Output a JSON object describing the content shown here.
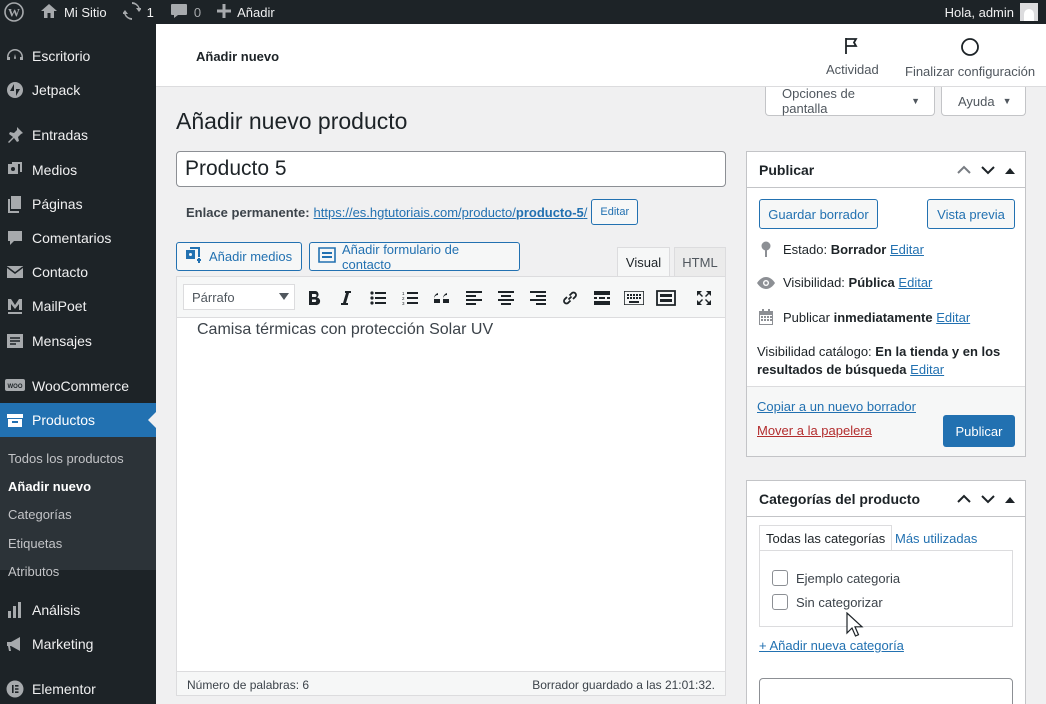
{
  "adminbar": {
    "site_name": "Mi Sitio",
    "updates_count": "1",
    "comments_count": "0",
    "new_label": "Añadir",
    "greeting": "Hola, admin"
  },
  "sidebar": {
    "items": [
      {
        "label": "Escritorio",
        "icon": "dashboard-icon"
      },
      {
        "label": "Jetpack",
        "icon": "jetpack-icon"
      },
      {
        "label": "Entradas",
        "icon": "pin-icon"
      },
      {
        "label": "Medios",
        "icon": "media-icon"
      },
      {
        "label": "Páginas",
        "icon": "pages-icon"
      },
      {
        "label": "Comentarios",
        "icon": "comments-icon"
      },
      {
        "label": "Contacto",
        "icon": "envelope-icon"
      },
      {
        "label": "MailPoet",
        "icon": "mailpoet-icon"
      },
      {
        "label": "Mensajes",
        "icon": "messages-icon"
      },
      {
        "label": "WooCommerce",
        "icon": "woo-icon"
      },
      {
        "label": "Productos",
        "icon": "archive-icon"
      },
      {
        "label": "Análisis",
        "icon": "chart-icon"
      },
      {
        "label": "Marketing",
        "icon": "megaphone-icon"
      },
      {
        "label": "Elementor",
        "icon": "elementor-icon"
      }
    ],
    "submenu": [
      "Todos los productos",
      "Añadir nuevo",
      "Categorías",
      "Etiquetas",
      "Atributos"
    ]
  },
  "header": {
    "title": "Añadir nuevo",
    "activity_label": "Actividad",
    "finish_setup_label": "Finalizar configuración"
  },
  "screen_meta": {
    "options_label": "Opciones de pantalla",
    "help_label": "Ayuda"
  },
  "page": {
    "heading": "Añadir nuevo producto",
    "title_value": "Producto 5",
    "permalink_label": "Enlace permanente:",
    "permalink_base": "https://es.hgtutoriais.com/producto/",
    "permalink_slug": "producto-5",
    "permalink_tail": "/",
    "permalink_edit": "Editar"
  },
  "editor": {
    "add_media_label": "Añadir medios",
    "add_form_label": "Añadir formulario de contacto",
    "tab_visual": "Visual",
    "tab_html": "HTML",
    "format_value": "Párrafo",
    "content": "Camisa térmicas con protección Solar UV",
    "word_count": "Número de palabras: 6",
    "saved_status": "Borrador guardado a las 21:01:32."
  },
  "publish": {
    "title": "Publicar",
    "save_draft": "Guardar borrador",
    "preview": "Vista previa",
    "status_label": "Estado:",
    "status_value": "Borrador",
    "visibility_label": "Visibilidad:",
    "visibility_value": "Pública",
    "publish_label": "Publicar",
    "publish_value": "inmediatamente",
    "catalog_label": "Visibilidad catálogo:",
    "catalog_value": "En la tienda y en los",
    "catalog_value2": "resultados de búsqueda",
    "edit": "Editar",
    "copy_draft": "Copiar a un nuevo borrador",
    "trash": "Mover a la papelera",
    "publish_button": "Publicar"
  },
  "categories": {
    "title": "Categorías del producto",
    "tab_all": "Todas las categorías",
    "tab_popular": "Más utilizadas",
    "items": [
      "Ejemplo categoria",
      "Sin categorizar"
    ],
    "add_new": "+ Añadir nueva categoría"
  }
}
